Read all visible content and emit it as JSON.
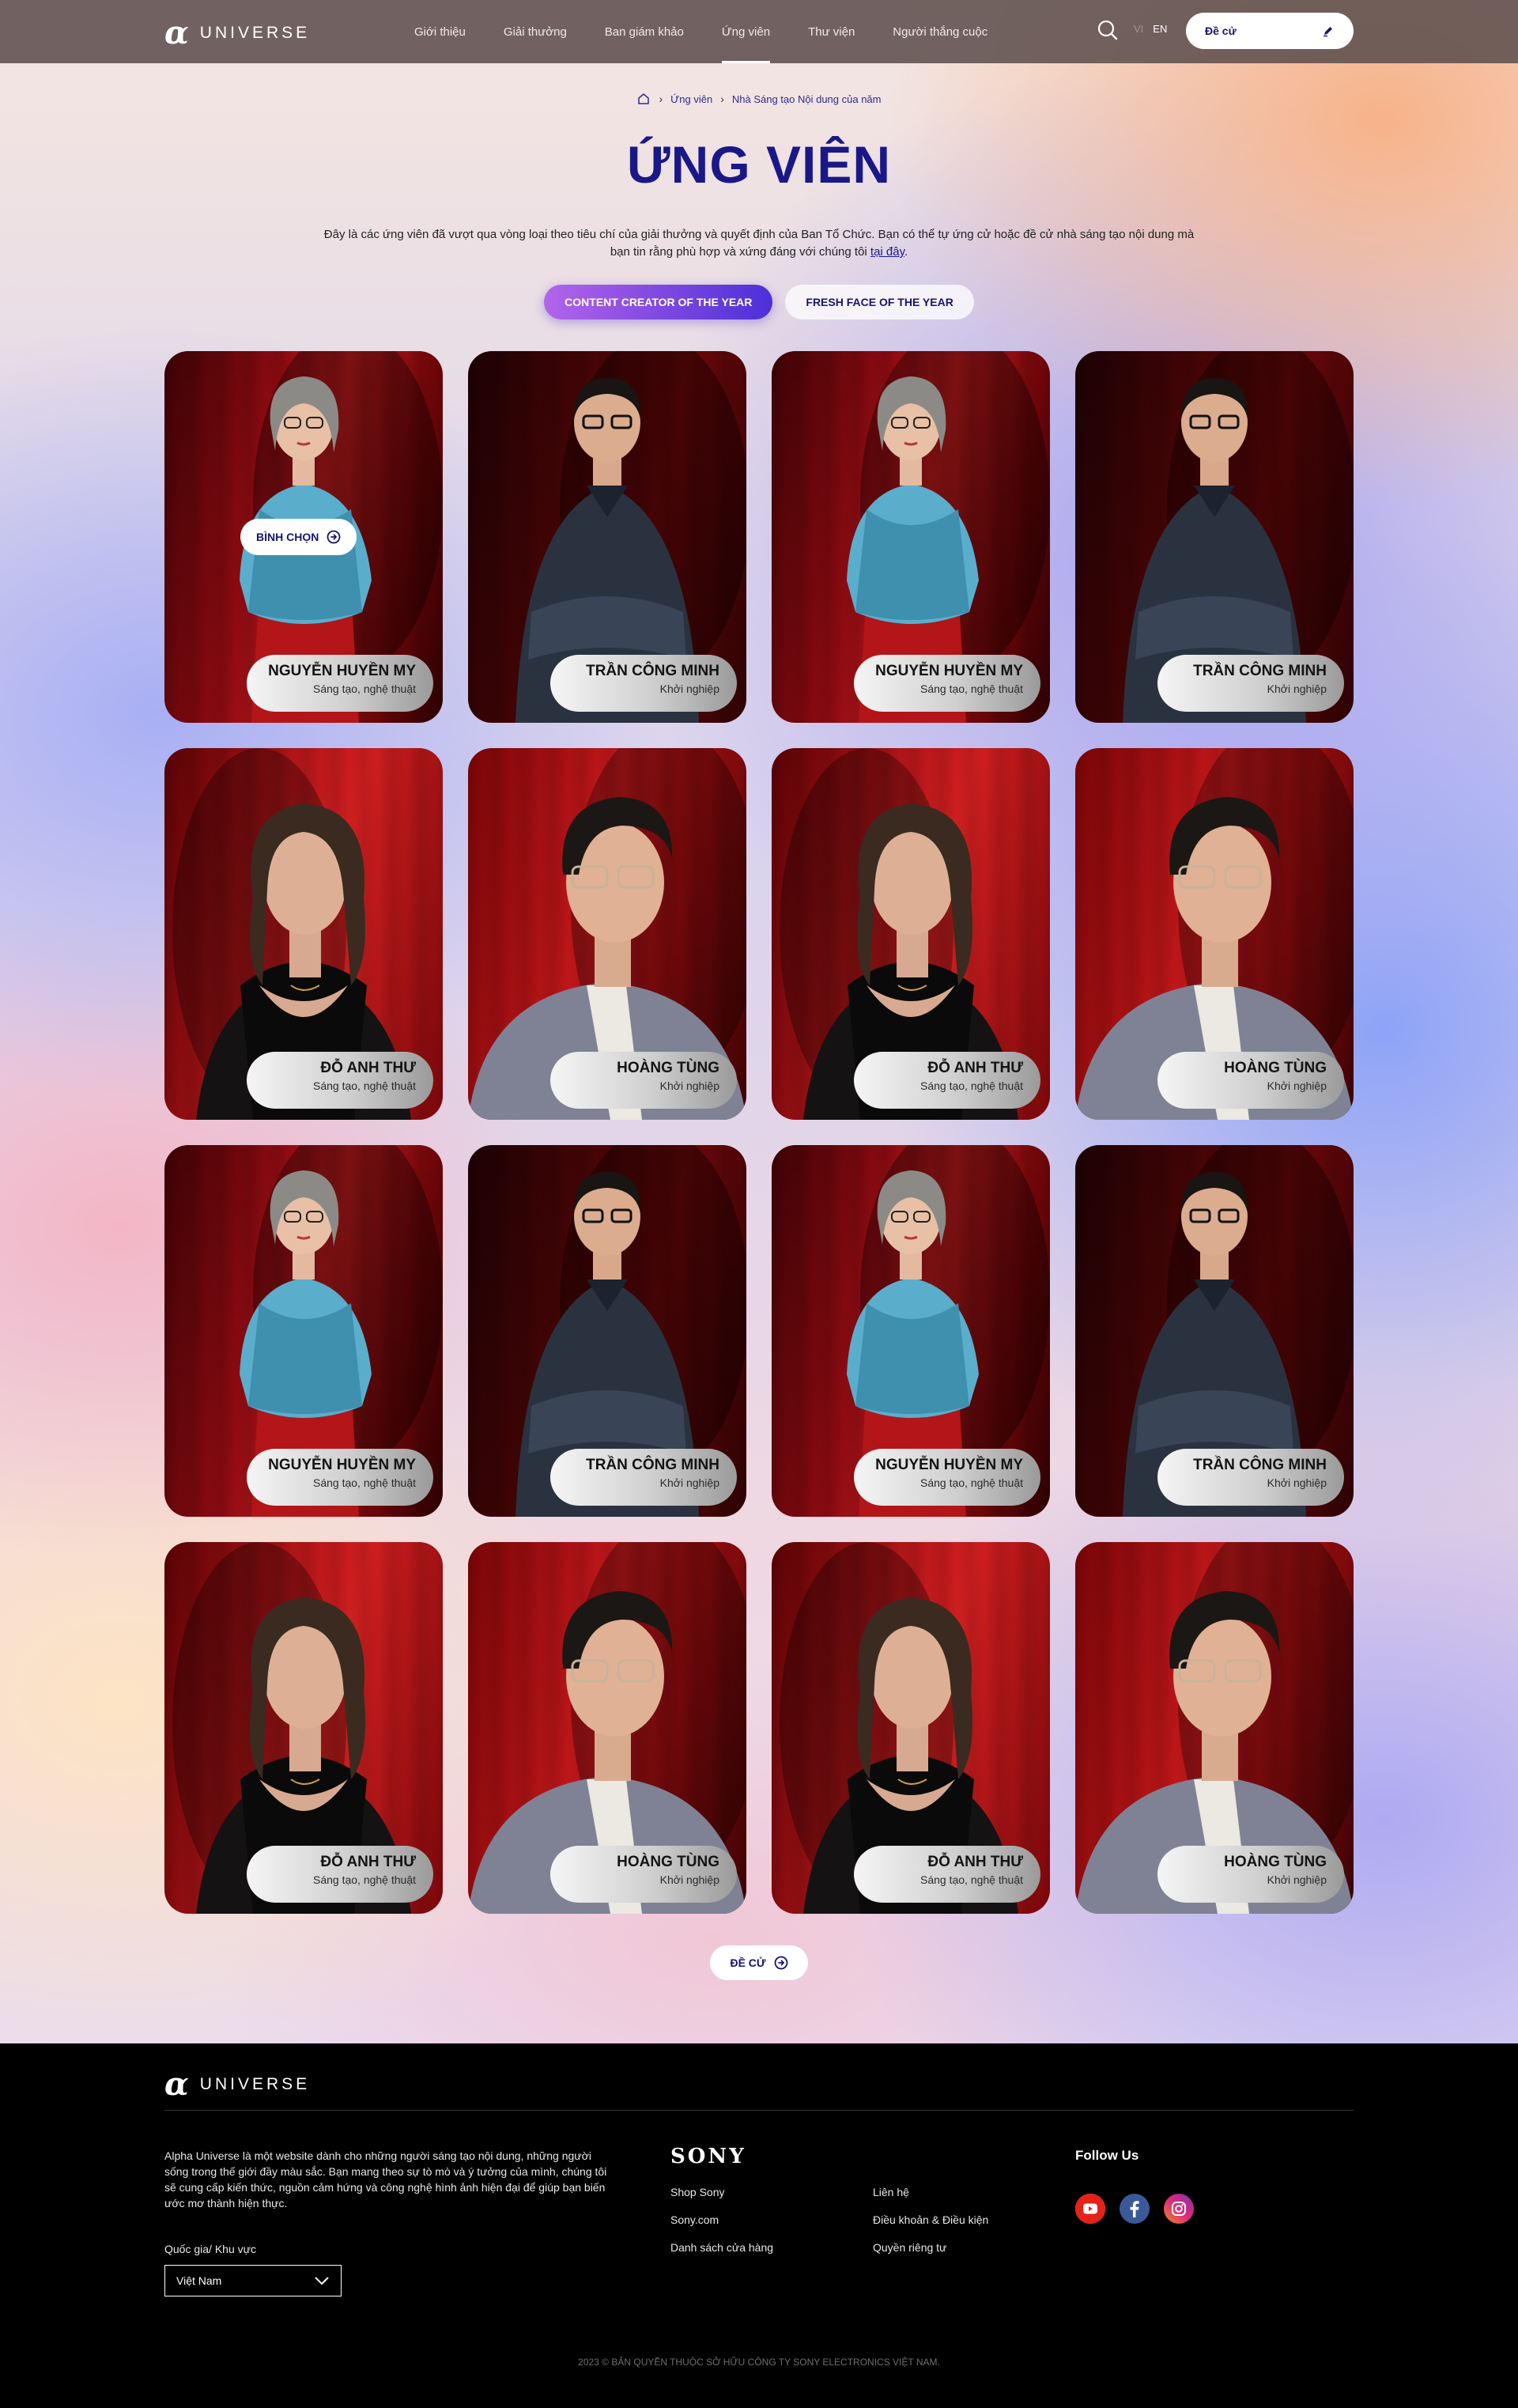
{
  "header": {
    "logo_mark": "α",
    "logo_text": "UNIVERSE",
    "nav": [
      "Giới thiệu",
      "Giải thưởng",
      "Ban giám khảo",
      "Ứng viên",
      "Thư viện",
      "Người thắng cuộc"
    ],
    "active_nav": "Ứng viên",
    "lang_vi": "VI",
    "lang_en": "EN",
    "nominate_label": "Đề cử"
  },
  "breadcrumb": {
    "level1": "Ứng viên",
    "level2": "Nhà Sáng tạo Nội dung của năm"
  },
  "page": {
    "title": "ỨNG VIÊN",
    "intro_text": "Đây là các ứng viên đã vượt qua vòng loại theo tiêu chí của giải thưởng và quyết định của Ban Tổ Chức. Bạn có thể tự ứng cử hoặc đề cử nhà sáng tạo nội dung mà bạn tin rằng phù hợp và xứng đáng với chúng tôi ",
    "intro_link": "tại đây",
    "intro_end": ".",
    "tab_active": "CONTENT CREATOR OF THE YEAR",
    "tab_inactive": "FRESH FACE OF THE YEAR",
    "vote_label": "BÌNH CHỌN",
    "nominate_button": "ĐỀ CỬ"
  },
  "candidates": [
    {
      "name": "NGUYỄN HUYỀN MY",
      "role": "Sáng tạo, nghệ thuật"
    },
    {
      "name": "TRẦN CÔNG MINH",
      "role": "Khởi nghiệp"
    },
    {
      "name": "NGUYỄN HUYỀN MY",
      "role": "Sáng tạo, nghệ thuật"
    },
    {
      "name": "TRẦN CÔNG MINH",
      "role": "Khởi nghiệp"
    },
    {
      "name": "ĐỖ ANH THƯ",
      "role": "Sáng tạo, nghệ thuật"
    },
    {
      "name": "HOÀNG TÙNG",
      "role": "Khởi nghiệp"
    },
    {
      "name": "ĐỖ ANH THƯ",
      "role": "Sáng tạo, nghệ thuật"
    },
    {
      "name": "HOÀNG TÙNG",
      "role": "Khởi nghiệp"
    },
    {
      "name": "NGUYỄN HUYỀN MY",
      "role": "Sáng tạo, nghệ thuật"
    },
    {
      "name": "TRẦN CÔNG MINH",
      "role": "Khởi nghiệp"
    },
    {
      "name": "NGUYỄN HUYỀN MY",
      "role": "Sáng tạo, nghệ thuật"
    },
    {
      "name": "TRẦN CÔNG MINH",
      "role": "Khởi nghiệp"
    },
    {
      "name": "ĐỖ ANH THƯ",
      "role": "Sáng tạo, nghệ thuật"
    },
    {
      "name": "HOÀNG TÙNG",
      "role": "Khởi nghiệp"
    },
    {
      "name": "ĐỖ ANH THƯ",
      "role": "Sáng tạo, nghệ thuật"
    },
    {
      "name": "HOÀNG TÙNG",
      "role": "Khởi nghiệp"
    }
  ],
  "footer": {
    "logo_mark": "α",
    "logo_text": "UNIVERSE",
    "about": "Alpha Universe là một website dành cho những người sáng tạo nội dung, những người sống trong thế giới đầy màu sắc. Bạn mang theo sự tò mò và ý tưởng của mình, chúng tôi sẽ cung cấp kiến thức, nguồn cảm hứng và công nghệ hình ảnh hiện đại để giúp bạn biến ước mơ thành hiện thực.",
    "country_label": "Quốc gia/ Khu vực",
    "country_value": "Việt Nam",
    "sony": "SONY",
    "links_col1": [
      "Shop Sony",
      "Sony.com",
      "Danh sách cửa hàng"
    ],
    "links_col2": [
      "Liên hệ",
      "Điều khoản & Điều kiện",
      "Quyền riêng tư"
    ],
    "follow_label": "Follow Us",
    "socials": [
      "youtube-icon",
      "facebook-icon",
      "instagram-icon"
    ],
    "copyright": "2023 © BẢN QUYỀN THUỘC SỞ HỮU CÔNG TY SONY ELECTRONICS VIỆT NAM."
  },
  "colors": {
    "brand_navy": "#1a1889",
    "tab_gradient_start": "#b364ea",
    "tab_gradient_end": "#4d2fd8",
    "youtube": "#e62117",
    "facebook": "#3b5998",
    "instagram_a": "#f58529",
    "instagram_b": "#dd2a7b"
  }
}
